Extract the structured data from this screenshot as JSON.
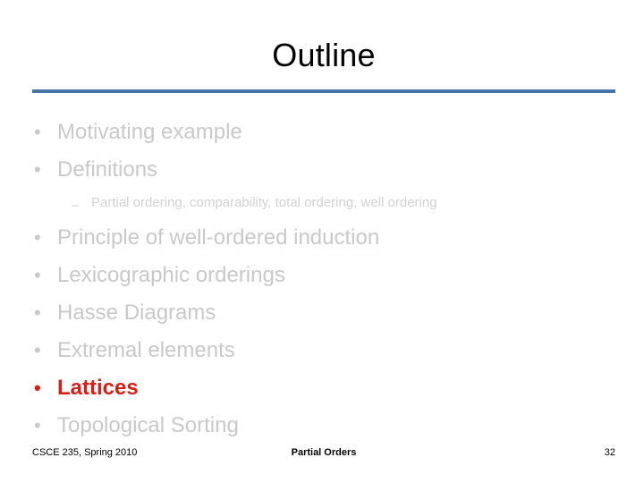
{
  "slide": {
    "title": "Outline",
    "accent_rule_color": "#4576A7",
    "highlight_color": "#D81F15",
    "dim_color": "#d2d2d2",
    "bullets": [
      {
        "level": 1,
        "marker": "•",
        "text": "Motivating example",
        "state": "dim"
      },
      {
        "level": 1,
        "marker": "•",
        "text": "Definitions",
        "state": "dim"
      },
      {
        "level": 2,
        "marker": "–",
        "text": "Partial ordering, comparability, total ordering, well ordering",
        "state": "dim"
      },
      {
        "level": 1,
        "marker": "•",
        "text": "Principle of well-ordered induction",
        "state": "dim"
      },
      {
        "level": 1,
        "marker": "•",
        "text": "Lexicographic orderings",
        "state": "dim"
      },
      {
        "level": 1,
        "marker": "•",
        "text": "Hasse Diagrams",
        "state": "dim"
      },
      {
        "level": 1,
        "marker": "•",
        "text": "Extremal elements",
        "state": "dim"
      },
      {
        "level": 1,
        "marker": "•",
        "text": "Lattices",
        "state": "highlight"
      },
      {
        "level": 1,
        "marker": "•",
        "text": "Topological Sorting",
        "state": "dim"
      }
    ]
  },
  "footer": {
    "course": "CSCE 235, Spring 2010",
    "topic": "Partial Orders",
    "page_number": "32"
  }
}
